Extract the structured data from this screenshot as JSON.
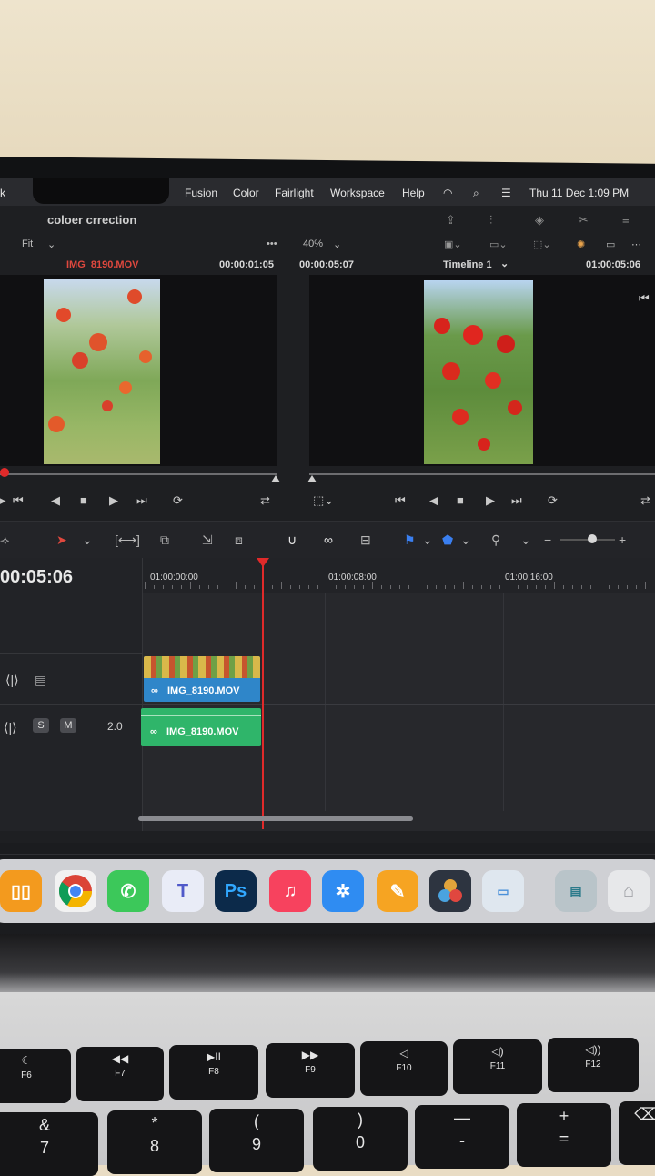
{
  "menubar": {
    "left_partial": "k",
    "items": [
      "Fusion",
      "Color",
      "Fairlight",
      "Workspace",
      "Help"
    ],
    "clock": "Thu 11 Dec  1:09 PM"
  },
  "project": {
    "title": "coloer crrection"
  },
  "source_viewer": {
    "fit": "Fit",
    "clip_name": "IMG_8190.MOV",
    "duration": "00:00:01:05"
  },
  "timeline_viewer": {
    "zoom": "40%",
    "timecode_left": "00:00:05:07",
    "timeline_name": "Timeline 1",
    "timecode_right": "01:00:05:06"
  },
  "timeline": {
    "current_tc": "00:05:06",
    "ruler": [
      "01:00:00:00",
      "01:00:08:00",
      "01:00:16:00"
    ],
    "video_clip": "IMG_8190.MOV",
    "audio_clip": "IMG_8190.MOV",
    "audio_level": "2.0",
    "solo": "S",
    "mute": "M"
  },
  "dock_apps": [
    "Books",
    "Chrome",
    "WhatsApp",
    "Teams",
    "Photoshop",
    "Music",
    "Safari",
    "Pages",
    "DaVinci Resolve",
    "Preview"
  ],
  "keyboard": {
    "row1": [
      {
        "sym": "☾",
        "label": "F6"
      },
      {
        "sym": "◀◀",
        "label": "F7"
      },
      {
        "sym": "▶II",
        "label": "F8"
      },
      {
        "sym": "▶▶",
        "label": "F9"
      },
      {
        "sym": "◁",
        "label": "F10"
      },
      {
        "sym": "◁)",
        "label": "F11"
      },
      {
        "sym": "◁))",
        "label": "F12"
      }
    ],
    "row2": [
      {
        "top": "&",
        "bottom": "7"
      },
      {
        "top": "*",
        "bottom": "8"
      },
      {
        "top": "(",
        "bottom": "9"
      },
      {
        "top": ")",
        "bottom": "0"
      },
      {
        "top": "—",
        "bottom": "-"
      },
      {
        "top": "+",
        "bottom": "="
      }
    ]
  }
}
